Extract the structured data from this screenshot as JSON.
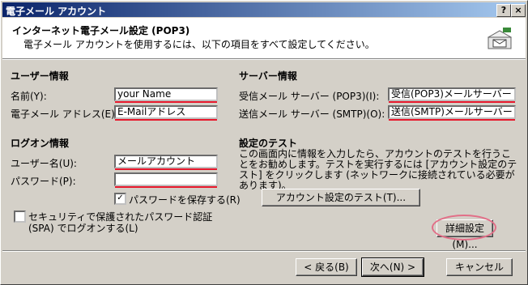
{
  "window": {
    "title": "電子メール アカウント",
    "help_label": "?",
    "close_label": "×"
  },
  "header": {
    "title": "インターネット電子メール設定 (POP3)",
    "subtitle": "電子メール アカウントを使用するには、以下の項目をすべて設定してください。"
  },
  "user_info": {
    "heading": "ユーザー情報",
    "name_label": "名前(Y):",
    "name_value": "your Name",
    "email_label": "電子メール アドレス(E):",
    "email_value": "E-Mailアドレス"
  },
  "server_info": {
    "heading": "サーバー情報",
    "incoming_label": "受信メール サーバー (POP3)(I):",
    "incoming_value": "受信(POP3)メールサーバー",
    "outgoing_label": "送信メール サーバー (SMTP)(O):",
    "outgoing_value": "送信(SMTP)メールサーバー"
  },
  "logon_info": {
    "heading": "ログオン情報",
    "user_label": "ユーザー名(U):",
    "user_value": "メールアカウント",
    "password_label": "パスワード(P):",
    "password_value": "",
    "save_password_label": "パスワードを保存する(R)",
    "save_password_checked": "✓",
    "spa_label_line1": "セキュリティで保護されたパスワード認証",
    "spa_label_line2": "(SPA) でログオンする(L)"
  },
  "test": {
    "heading": "設定のテスト",
    "description": "この画面内に情報を入力したら、アカウントのテストを行うことをお勧めします。テストを実行するには [アカウント設定のテスト] をクリックします (ネットワークに接続されている必要があります)。",
    "test_button": "アカウント設定のテスト(T)..."
  },
  "buttons": {
    "details": "詳細設定(M)...",
    "back": "< 戻る(B)",
    "next": "次へ(N) >",
    "cancel": "キャンセル"
  },
  "colors": {
    "underline": "#e8182c",
    "circle": "#e26f88"
  }
}
